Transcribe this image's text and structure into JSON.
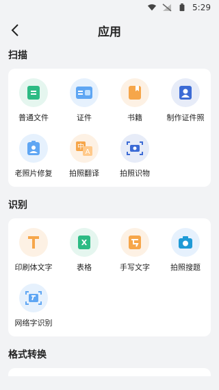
{
  "status": {
    "time": "5:29"
  },
  "header": {
    "title": "应用"
  },
  "sections": [
    {
      "title": "扫描",
      "items": [
        {
          "label": "普通文件",
          "icon": "document-icon"
        },
        {
          "label": "证件",
          "icon": "id-card-icon"
        },
        {
          "label": "书籍",
          "icon": "book-icon"
        },
        {
          "label": "制作证件照",
          "icon": "portrait-icon"
        },
        {
          "label": "老照片修复",
          "icon": "photo-restore-icon"
        },
        {
          "label": "拍照翻译",
          "icon": "translate-icon"
        },
        {
          "label": "拍照识物",
          "icon": "object-recognition-icon"
        }
      ]
    },
    {
      "title": "识别",
      "items": [
        {
          "label": "印刷体文字",
          "icon": "text-T-icon"
        },
        {
          "label": "表格",
          "icon": "excel-table-icon"
        },
        {
          "label": "手写文字",
          "icon": "handwriting-icon"
        },
        {
          "label": "拍照搜题",
          "icon": "camera-search-icon"
        },
        {
          "label": "网络字识别",
          "icon": "web-text-scan-icon"
        }
      ]
    },
    {
      "title": "格式转换"
    }
  ],
  "colors": {
    "green_bg": "#e5f6ef",
    "green": "#2dbb84",
    "blue_bg": "#e6f1fd",
    "blue": "#5fa6f3",
    "orange_bg": "#fdf1e4",
    "orange": "#f6a64a",
    "navy_bg": "#e7ecf8",
    "navy": "#3c6bd5"
  }
}
